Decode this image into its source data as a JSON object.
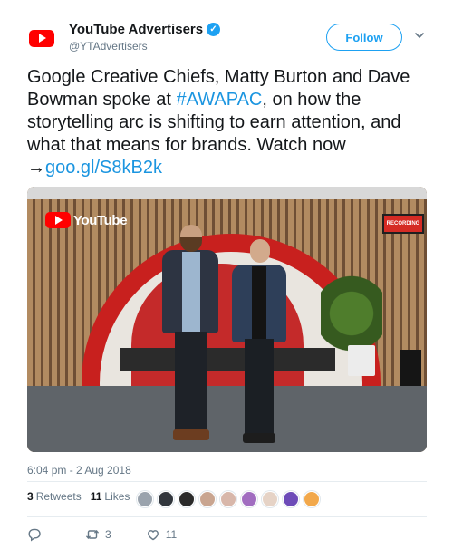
{
  "tweet": {
    "author": {
      "name": "YouTube Advertisers",
      "handle": "@YTAdvertisers"
    },
    "follow_label": "Follow",
    "text": {
      "intro": "Google Creative Chiefs, Matty Burton and Dave Bowman spoke at ",
      "hashtag": "#AWAPAC",
      "middle": ", on how the storytelling arc is shifting to earn attention, and what that means for brands. Watch now →",
      "link": "goo.gl/S8kB2k"
    },
    "media": {
      "logo_text": "YouTube",
      "sign_text": "RECORDING"
    },
    "timestamp": "6:04 pm - 2 Aug 2018",
    "stats": {
      "retweets_count": "3",
      "retweets_label": "Retweets",
      "likes_count": "11",
      "likes_label": "Likes"
    },
    "actions": {
      "retweet_count": "3",
      "like_count": "11"
    }
  },
  "colors": {
    "accent": "#1da1f2",
    "link": "#1b95e0",
    "muted": "#657786",
    "youtube_red": "#ff0000"
  },
  "liker_avatars": [
    {
      "color": "#9aa3ad"
    },
    {
      "color": "#31363d"
    },
    {
      "color": "#2a2a2a"
    },
    {
      "color": "#c9a590"
    },
    {
      "color": "#d8b7aa"
    },
    {
      "color": "#a16dc0"
    },
    {
      "color": "#e6d3c6"
    },
    {
      "color": "#6d4bb8"
    },
    {
      "color": "#f2a84b"
    }
  ]
}
